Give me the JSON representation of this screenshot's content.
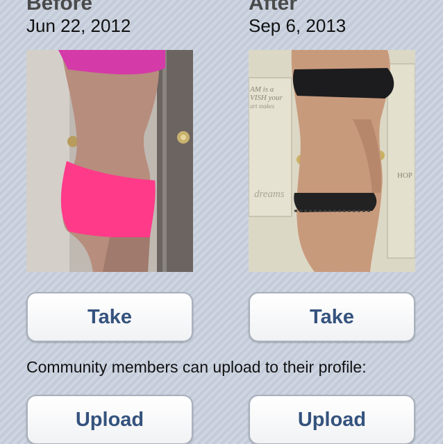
{
  "before": {
    "heading": "Before",
    "date": "Jun 22, 2012",
    "take_label": "Take",
    "upload_label": "Upload"
  },
  "after": {
    "heading": "After",
    "date": "Sep 6, 2013",
    "take_label": "Take",
    "upload_label": "Upload",
    "wall_text": {
      "line1": "AM is a",
      "line2": "VISH your",
      "line3": "art makes",
      "dreams": "dreams",
      "hop": "HOP"
    }
  },
  "community_caption": "Community members can upload to their profile:",
  "colors": {
    "button_text": "#34527d",
    "button_border": "#a9b1bd",
    "background": "#c9d1de"
  }
}
